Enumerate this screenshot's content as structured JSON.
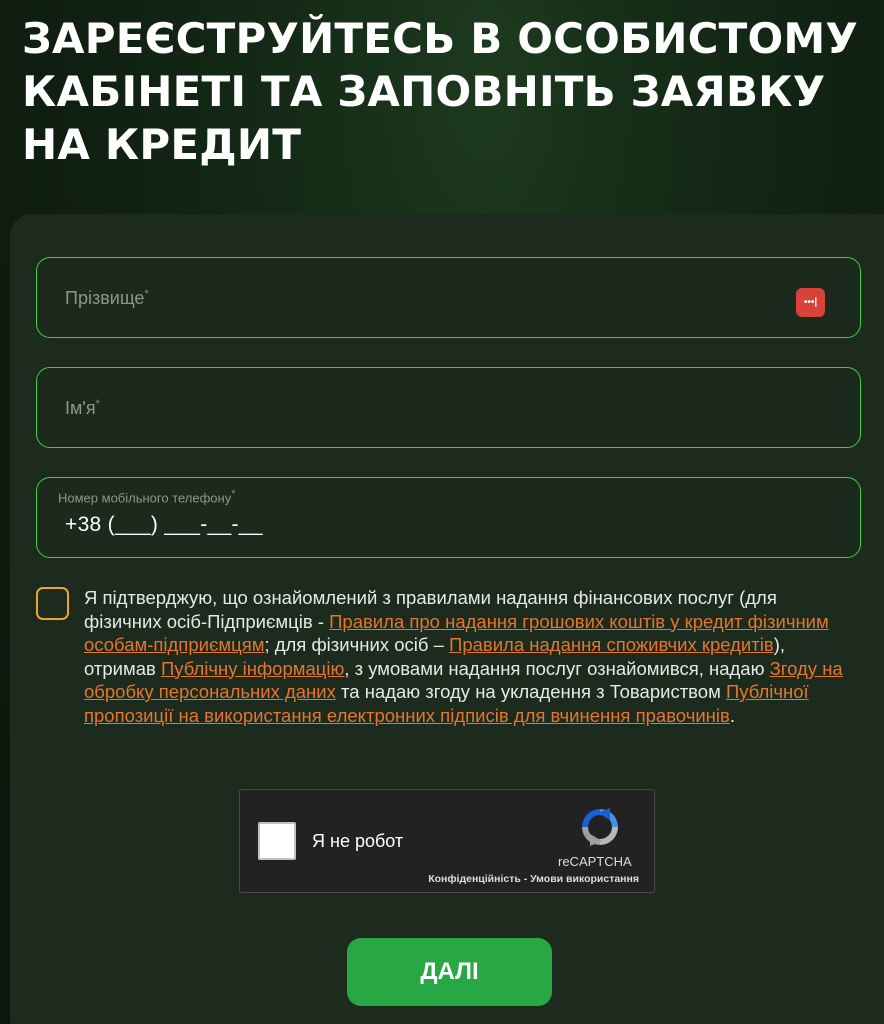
{
  "page": {
    "title": "ЗАРЕЄСТРУЙТЕСЬ В ОСОБИСТОМУ КАБІНЕТІ ТА ЗАПОВНІТЬ ЗАЯВКУ НА КРЕДИТ"
  },
  "form": {
    "surname": {
      "label": "Прізвище",
      "required_mark": "*",
      "value": ""
    },
    "name": {
      "label": "Ім'я",
      "required_mark": "*",
      "value": ""
    },
    "phone": {
      "label": "Номер мобільного телефону",
      "required_mark": "*",
      "value": "+38 (___) ___-__-__"
    },
    "password_manager_icon": "•••|"
  },
  "consent": {
    "checked": false,
    "t1": "Я підтверджую, що ознайомлений з правилами надання фінансових послуг (для фізичних осіб-Підприємців - ",
    "link1": "Правила про надання грошових коштів у кредит фізичним особам-підприємцям",
    "t2": "; для фізичних осіб – ",
    "link2": "Правила надання споживчих кредитів",
    "t3": "), отримав ",
    "link3": "Публічну інформацію",
    "t4": ", з умовами надання послуг ознайомився, надаю ",
    "link4": "Згоду на обробку персональних даних",
    "t5": " та надаю згоду на укладення з Товариством ",
    "link5": "Публічної пропозиції на використання електронних підписів для вчинення правочинів",
    "t6": "."
  },
  "recaptcha": {
    "label": "Я не робот",
    "brand": "reCAPTCHA",
    "privacy": "Конфіденційність",
    "separator": " - ",
    "terms": "Умови використання"
  },
  "actions": {
    "next_label": "ДАЛІ"
  },
  "colors": {
    "field_border": "#3ccf3f",
    "link": "#e4762d",
    "checkbox_border": "#e8a72c",
    "button": "#28a745"
  }
}
